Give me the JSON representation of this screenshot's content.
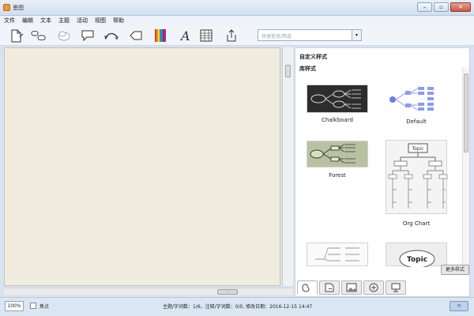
{
  "window": {
    "title": "思图",
    "minimize": "–",
    "maximize": "▫",
    "close": "✕"
  },
  "menu": {
    "items": [
      "文件",
      "编辑",
      "文本",
      "主题",
      "活动",
      "视图",
      "帮助"
    ]
  },
  "toolbar": {
    "icons": [
      "new-doc-icon",
      "topic-icon",
      "subtopic-icon",
      "floating-topic-icon",
      "callout-icon",
      "relationship-icon",
      "boundary-icon",
      "color-palette-icon",
      "font-icon",
      "table-icon",
      "export-icon"
    ]
  },
  "search": {
    "placeholder": "快速查找/筛选",
    "dropdown": "▾"
  },
  "panel": {
    "section_custom": "自定义样式",
    "section_library": "库样式",
    "styles": [
      {
        "name": "Chalkboard"
      },
      {
        "name": "Default"
      },
      {
        "name": "Forest"
      },
      {
        "name": "Org Chart"
      },
      {
        "name": ""
      },
      {
        "name": ""
      }
    ],
    "topic_label": "Topic",
    "more_button": "更多样式"
  },
  "statusbar": {
    "zoom": "100%",
    "focus_label": "焦点",
    "info": "主题/字词数：1/6，注释/字词数：0/0, 修改日期：2016-12-15 14:47"
  },
  "scroll": {
    "hthumb": "⋯"
  },
  "colors": {
    "canvas": "#f1ece0",
    "chalkboard": "#2d2d2d",
    "forest": "#b9c2a0",
    "default_accent": "#6a7ee8"
  }
}
